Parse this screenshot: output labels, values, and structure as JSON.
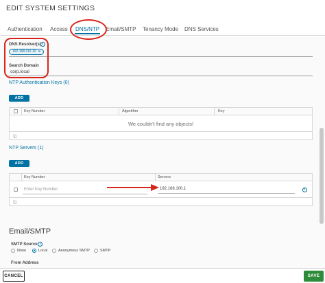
{
  "dialog": {
    "title": "EDIT SYSTEM SETTINGS"
  },
  "tabs": [
    {
      "label": "Authentication",
      "active": false
    },
    {
      "label": "Access",
      "active": false
    },
    {
      "label": "DNS/NTP",
      "active": true
    },
    {
      "label": "Email/SMTP",
      "active": false
    },
    {
      "label": "Tenancy Mode",
      "active": false
    },
    {
      "label": "DNS Services",
      "active": false
    }
  ],
  "dns": {
    "resolvers_label": "DNS Resolver(s)",
    "resolver_value": "192.168.110.10",
    "search_domain_label": "Search Domain",
    "search_domain_value": "corp.local"
  },
  "ntp_auth_keys": {
    "title": "NTP Authentication Keys (0)",
    "add_label": "ADD",
    "columns": [
      "Key Number",
      "Algorithm",
      "Key"
    ],
    "empty_message": "We couldn't find any objects!"
  },
  "ntp_servers": {
    "title": "NTP Servers (1)",
    "add_label": "ADD",
    "columns": [
      "Key Number",
      "Servers"
    ],
    "row": {
      "key_placeholder": "Enter Key Number",
      "server_value": "192.168.100.1"
    }
  },
  "email_smtp": {
    "title": "Email/SMTP",
    "smtp_source_label": "SMTP Source",
    "options": [
      "None",
      "Local",
      "Anonymous SMTP",
      "SMTP"
    ],
    "selected": "Local",
    "from_address_label": "From Address"
  },
  "footer": {
    "cancel_label": "CANCEL",
    "save_label": "SAVE"
  },
  "colors": {
    "accent": "#0072a3",
    "save": "#2e8b3a",
    "annotation": "#d9241a"
  }
}
